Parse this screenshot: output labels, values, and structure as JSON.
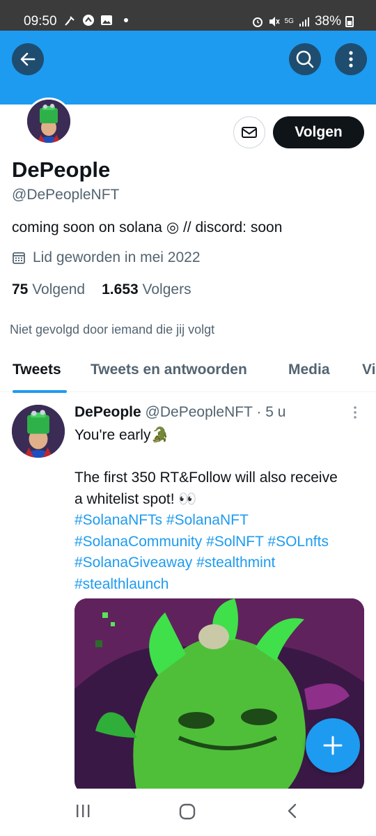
{
  "status_bar": {
    "time": "09:50",
    "signal_label": "5G",
    "battery": "38%"
  },
  "profile": {
    "display_name": "DePeople",
    "handle": "@DePeopleNFT",
    "bio": "coming soon on solana ◎ // discord: soon",
    "joined": "Lid geworden in mei 2022",
    "following_count": "75",
    "following_label": "Volgend",
    "followers_count": "1.653",
    "followers_label": "Volgers",
    "follow_button": "Volgen",
    "not_followed_text": "Niet gevolgd door iemand die jij volgt"
  },
  "tabs": [
    {
      "label": "Tweets",
      "active": true
    },
    {
      "label": "Tweets en antwoorden",
      "active": false
    },
    {
      "label": "Media",
      "active": false
    },
    {
      "label": "Vi",
      "active": false
    }
  ],
  "tweet": {
    "name": "DePeople",
    "handle": "@DePeopleNFT",
    "time": "· 5 u",
    "line1": "You're early🐊",
    "line2": "The first 350 RT&Follow will also receive",
    "line3": "a whitelist spot! 👀",
    "hashtags": [
      "#SolanaNFTs #SolanaNFT",
      "#SolanaCommunity #SolNFT #SOLnfts",
      "#SolanaGiveaway #stealthmint",
      "#stealthlaunch"
    ]
  },
  "icons": {
    "back": "arrow-left-icon",
    "search": "search-icon",
    "more": "more-vertical-icon",
    "message": "mail-icon",
    "calendar": "calendar-icon",
    "compose": "plus-icon"
  },
  "colors": {
    "accent": "#1d9bf0",
    "text": "#0f1419",
    "secondary": "#536471"
  }
}
